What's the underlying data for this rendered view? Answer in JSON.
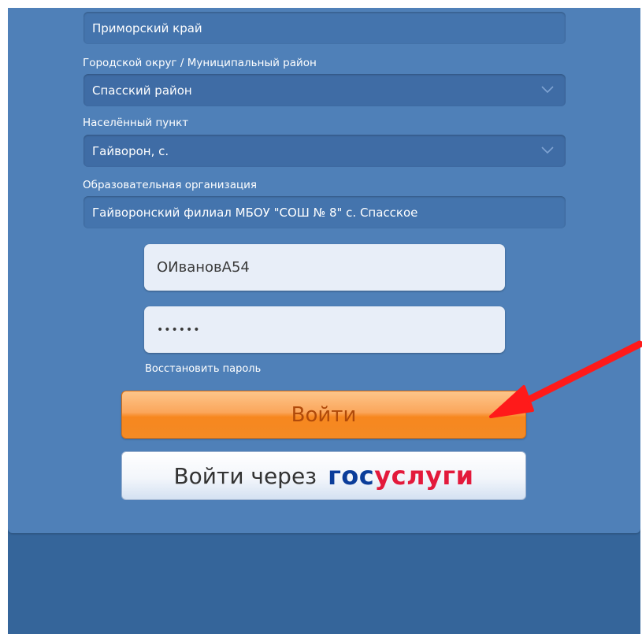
{
  "form": {
    "region": {
      "value": "Приморский край"
    },
    "district": {
      "label": "Городской округ / Муниципальный район",
      "value": "Спасский район"
    },
    "settlement": {
      "label": "Населённый пункт",
      "value": "Гайворон, с."
    },
    "organization": {
      "label": "Образовательная организация",
      "value": "Гайворонский филиал МБОУ \"СОШ № 8\" с. Спасское"
    },
    "login": {
      "value": "ОИвановА54"
    },
    "password": {
      "value": "••••••"
    },
    "restore_label": "Восстановить пароль",
    "login_button": "Войти",
    "gosuslugi_button": {
      "prefix": "Войти через",
      "logo_part1": "гос",
      "logo_part2": "услуги"
    }
  },
  "colors": {
    "panel": "#4f80b8",
    "background": "#35659a",
    "login_button": "#f7871f",
    "gos_blue": "#0b3d9a",
    "gos_red": "#e3193b",
    "annotation_arrow": "#ff1a1a"
  },
  "icons": {
    "dropdown": "chevron-down-icon",
    "annotation": "red-arrow-icon"
  }
}
